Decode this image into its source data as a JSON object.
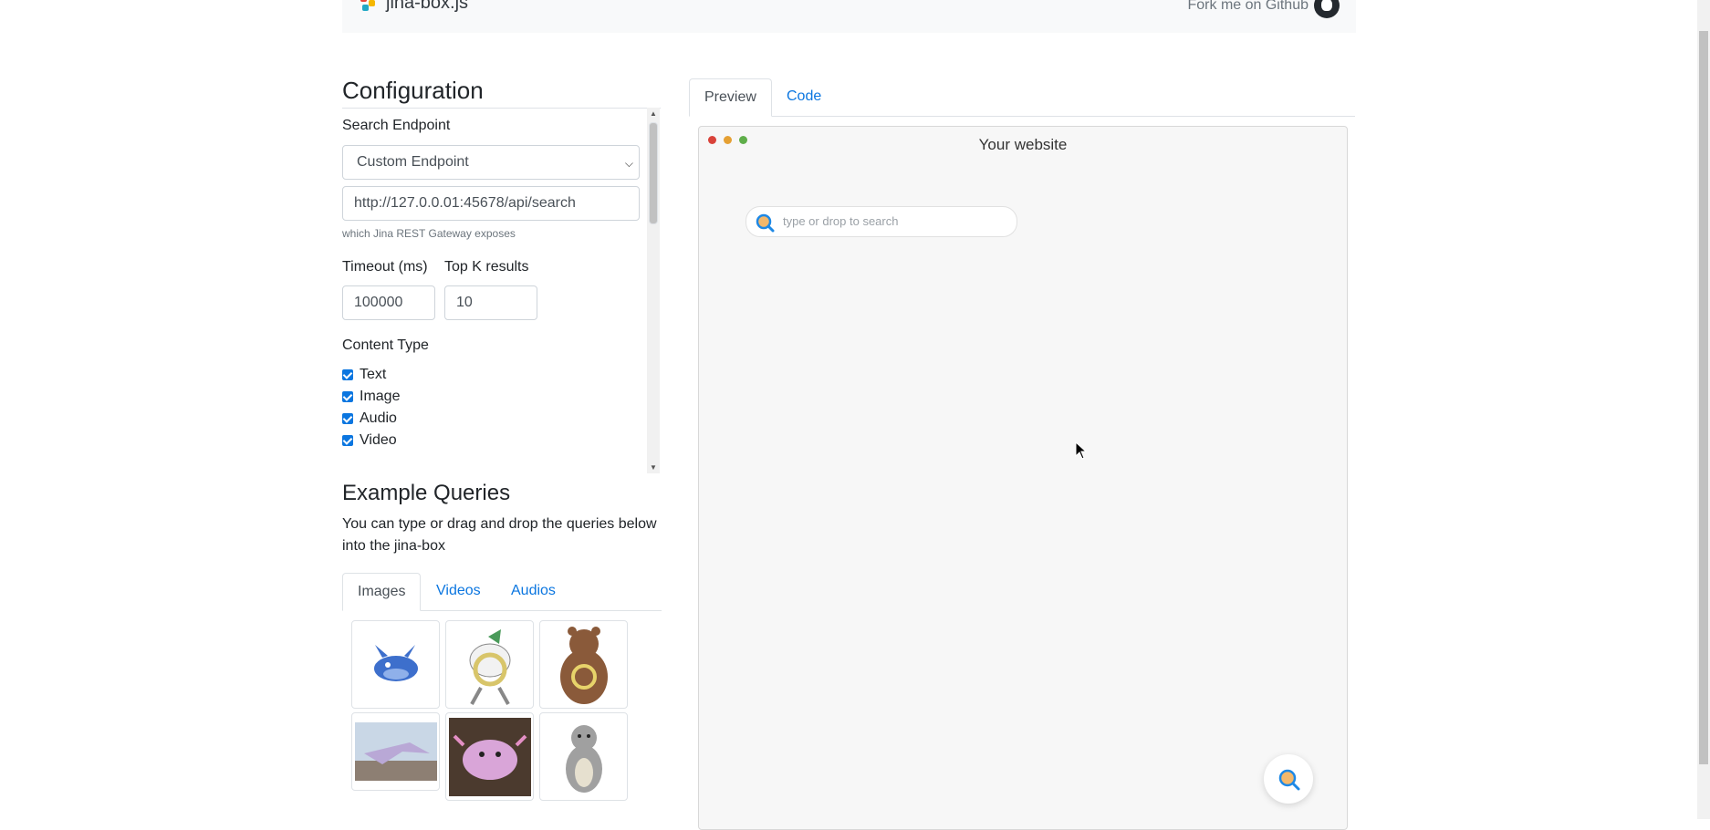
{
  "navbar": {
    "brand": "jina-box.js",
    "fork_label": "Fork me on Github"
  },
  "config": {
    "title": "Configuration",
    "search_endpoint_label": "Search Endpoint",
    "endpoint_select_value": "Custom Endpoint",
    "endpoint_url": "http://127.0.0.01:45678/api/search",
    "endpoint_help": "which Jina REST Gateway exposes",
    "timeout_label": "Timeout (ms)",
    "timeout_value": "100000",
    "topk_label": "Top K results",
    "topk_value": "10",
    "content_type_label": "Content Type",
    "content_types": [
      "Text",
      "Image",
      "Audio",
      "Video"
    ]
  },
  "examples": {
    "title": "Example Queries",
    "description": "You can type or drag and drop the queries below into the jina-box",
    "tabs": [
      "Images",
      "Videos",
      "Audios"
    ],
    "active_tab": "Images",
    "thumbnails": [
      {
        "icon": "blue-fish-pokemon-icon",
        "color": "#3d6fcc"
      },
      {
        "icon": "white-gold-pokemon-icon",
        "color": "#d8c56a"
      },
      {
        "icon": "brown-bear-pokemon-icon",
        "color": "#8a5a3a"
      },
      {
        "icon": "purple-bird-photo-icon",
        "color": "#b9a8d6"
      },
      {
        "icon": "pink-axolotl-photo-icon",
        "color": "#d9a5d8"
      },
      {
        "icon": "grey-dog-pokemon-icon",
        "color": "#a0a0a0"
      }
    ]
  },
  "preview": {
    "tabs": [
      "Preview",
      "Code"
    ],
    "active_tab": "Preview",
    "site_title": "Your website",
    "search_placeholder": "type or drop to search"
  },
  "colors": {
    "accent": "#0b76e0",
    "dot_red": "#d9433a",
    "dot_yellow": "#e5a033",
    "dot_green": "#5fae4a"
  }
}
